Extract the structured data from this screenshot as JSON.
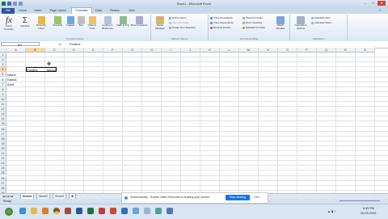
{
  "window": {
    "title": "Book1 - Microsoft Excel"
  },
  "tabs": [
    "File",
    "Home",
    "Insert",
    "Page Layout",
    "Formulas",
    "Data",
    "Review",
    "View"
  ],
  "active_tab": "Formulas",
  "ribbon": {
    "library": {
      "insert_function": "Insert Function",
      "autosum": "AutoSum",
      "recently_used": "Recently Used",
      "financial": "Financial",
      "logical": "Logical",
      "text": "Text",
      "date_time": "Date & Time",
      "lookup": "Lookup & Reference",
      "math": "Math & Trig",
      "more": "More Functions",
      "label": "Function Library"
    },
    "names": {
      "name_manager": "Name Manager",
      "define_name": "Define Name",
      "use_in_formula": "Use in Formula",
      "create_from_selection": "Create from Selection",
      "label": "Defined Names"
    },
    "auditing": {
      "trace_precedents": "Trace Precedents",
      "trace_dependents": "Trace Dependents",
      "remove_arrows": "Remove Arrows",
      "show_formulas": "Show Formulas",
      "error_checking": "Error Checking",
      "evaluate_formula": "Evaluate Formula",
      "watch_window": "Watch Window",
      "label": "Formula Auditing"
    },
    "calculation": {
      "options": "Calculation Options",
      "calc_now": "Calculate Now",
      "calc_sheet": "Calculate Sheet",
      "label": "Calculation"
    }
  },
  "formula_bar": {
    "name_box": "B4",
    "fx": "fx",
    "content": "Posters"
  },
  "columns": [
    "A",
    "B",
    "C",
    "D",
    "E",
    "F",
    "G",
    "H",
    "I",
    "J",
    "K",
    "L",
    "M",
    "N",
    "O",
    "P",
    "Q",
    "R",
    "S"
  ],
  "rows": [
    "1",
    "2",
    "3",
    "4",
    "5",
    "6",
    "7",
    "8",
    "9",
    "10",
    "11",
    "12",
    "13",
    "14",
    "15",
    "16",
    "17",
    "18",
    "19",
    "20",
    "21",
    "22",
    "23",
    "24",
    "25",
    "26",
    "27",
    "28",
    "29"
  ],
  "cells": {
    "b4": "Posters",
    "c4": "Tattoos",
    "a5": "Name",
    "a6": "Kamal",
    "a7": "Amit"
  },
  "sheets": [
    "Sheet1",
    "Sheet2",
    "Sheet3"
  ],
  "status": "Ready",
  "share_banner": {
    "text": "Screencastify - Screen Video Recorder is sharing your screen.",
    "stop": "Stop sharing",
    "hide": "Hide"
  },
  "clock": {
    "time": "6:35 PM",
    "date": "26-09-2020"
  },
  "colors": {
    "accent": "#2b579a",
    "tab_bg": "#c8d9ee",
    "stop_button": "#1a73e8"
  }
}
